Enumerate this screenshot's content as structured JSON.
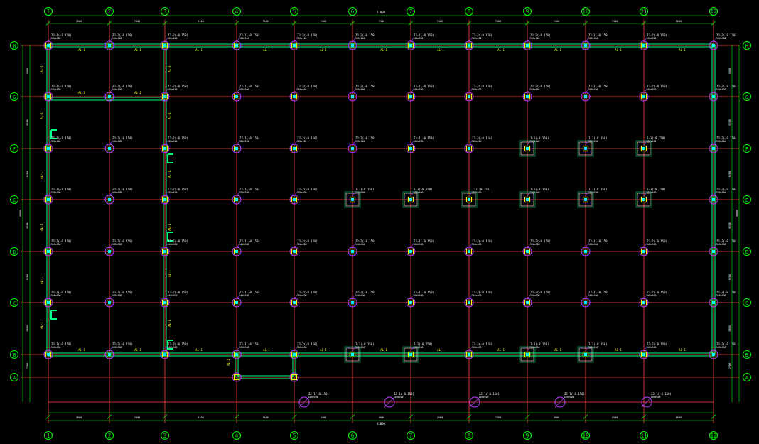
{
  "drawing": {
    "columns": [
      "1",
      "2",
      "3",
      "4",
      "5",
      "6",
      "7",
      "8",
      "9",
      "10",
      "11",
      "12"
    ],
    "rows": [
      "H",
      "G",
      "F",
      "E",
      "D",
      "C",
      "B",
      "A"
    ],
    "total_dim_top": "81000",
    "total_dim_bottom": "81000",
    "bay_dims_top": [
      "7800",
      "7800",
      "9100",
      "7400",
      "7400",
      "7400",
      "7400",
      "7400",
      "7400",
      "7400",
      "8600"
    ],
    "bay_dims_bottom": [
      "7800",
      "7800",
      "9100",
      "7400",
      "3400",
      "4000",
      "2500",
      "7400",
      "4900",
      "2500",
      "8600"
    ],
    "row_dims_left": [
      "5600",
      "6700",
      "6700",
      "6700",
      "6700",
      "5800",
      "2700"
    ],
    "row_dims_right": [
      "5600",
      "6700",
      "6700",
      "6700",
      "6700",
      "5800",
      "2700"
    ],
    "total_dim_left": "40800",
    "total_dim_right": "40800",
    "beam_tag": "AL-1",
    "wall_tag": "AL-1",
    "column_tag_a": "ZJ-1(-0.150)",
    "column_tag_b": "ZJ-2(-0.150)",
    "column_tag_c": "J-1(-0.150)",
    "column_sub_tag": "500x500",
    "colors": {
      "axis": "#ff4040",
      "bubble": "#00ff00",
      "dim": "#00ff00",
      "beam": "#00ff80",
      "column": "#ffff00",
      "footing": "#c040ff",
      "text": "#ffffff",
      "cyan": "#00ffff"
    }
  }
}
